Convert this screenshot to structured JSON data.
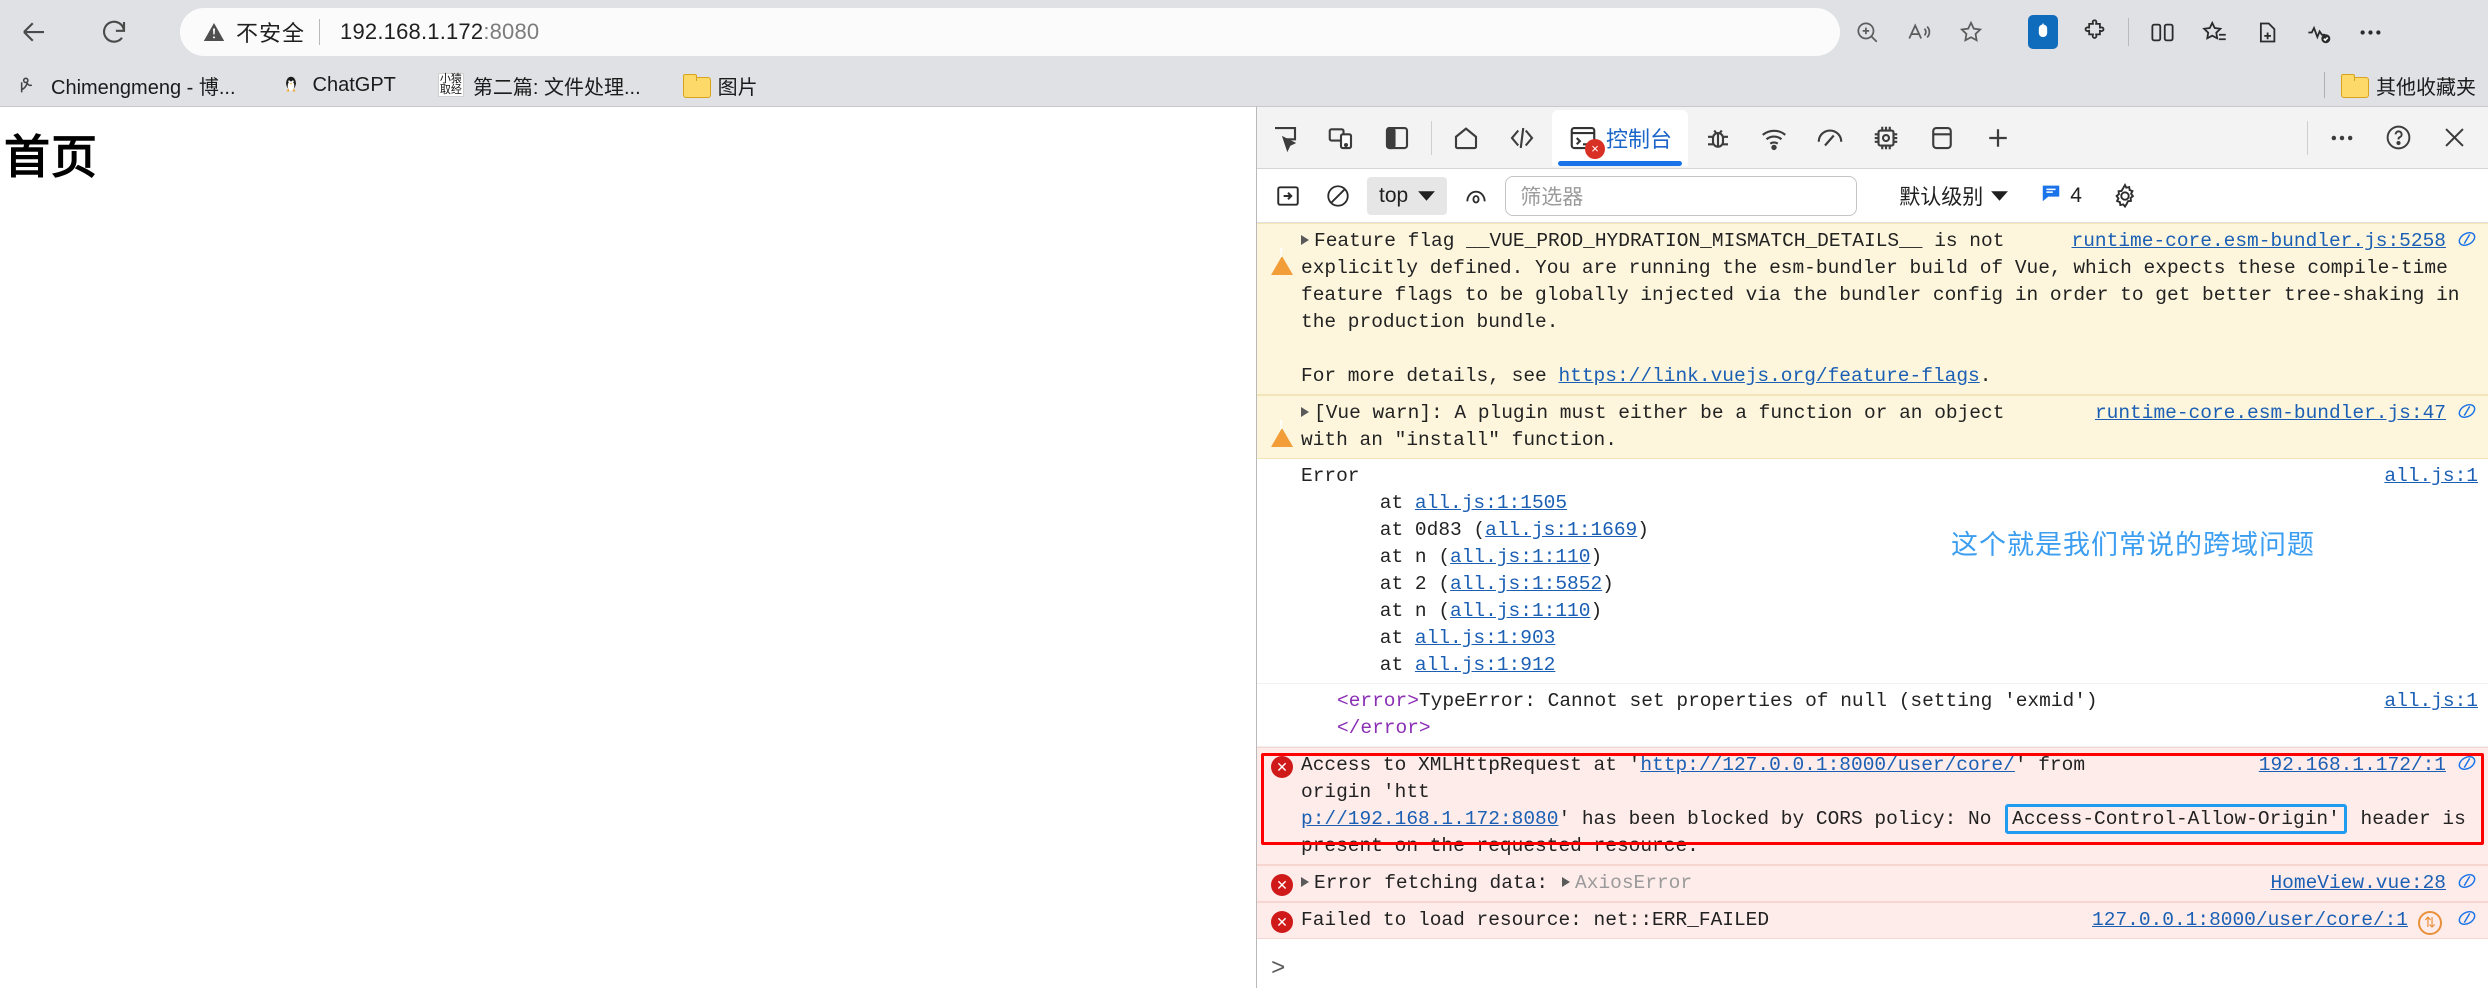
{
  "browser": {
    "nav": {
      "back": "back-arrow",
      "reload": "reload"
    },
    "omnibox": {
      "security_label": "不安全",
      "url_main": "192.168.1.172",
      "url_port": ":8080"
    },
    "bookmarks": [
      {
        "label": "Chimengmeng - 博...",
        "icon": "blog-icon"
      },
      {
        "label": "ChatGPT",
        "icon": "penguin-icon"
      },
      {
        "label": "第二篇: 文件处理...",
        "icon": "xiaoyuan-icon",
        "icon_text_1": "小猿",
        "icon_text_2": "取经"
      },
      {
        "label": "图片",
        "icon": "folder-icon"
      }
    ],
    "bookmarks_right": {
      "label": "其他收藏夹",
      "icon": "folder-icon"
    }
  },
  "page": {
    "title": "首页"
  },
  "devtools": {
    "toolbar": {
      "inspect": "inspect-element-icon",
      "device": "device-toolbar-icon",
      "dock": "dock-panel-icon",
      "home": "home-icon",
      "elements": "elements-code-icon",
      "console_tab": "控制台",
      "console_error_badge": "×",
      "debugger": "bug-icon",
      "network": "network-wifi-icon",
      "performance": "performance-gauge-icon",
      "memory": "memory-chip-icon",
      "application": "application-database-icon",
      "add_tab": "plus-icon",
      "more": "more-options-icon",
      "help": "help-icon",
      "close": "close-icon"
    },
    "filterbar": {
      "sidebar_toggle": "console-sidebar-icon",
      "clear": "clear-console-icon",
      "context": "top",
      "eye": "live-expression-icon",
      "filter_placeholder": "筛选器",
      "level": "默认级别",
      "issues_count": "4",
      "settings": "settings-gear-icon"
    },
    "console": {
      "rows": [
        {
          "id": "vue-feature-flag",
          "severity": "warning",
          "expandable": true,
          "text_line1": "Feature flag __VUE_PROD_HYDRATION_MISMATCH_DETAILS__ is not",
          "text_line2": "explicitly defined. You are running the esm-bundler build of Vue, which expects these compile-time",
          "text_line3": "feature flags to be globally injected via the bundler config in order to get better tree-shaking in",
          "text_line4": "the production bundle.",
          "text_line5_pre": "For more details, see ",
          "text_line5_link": "https://link.vuejs.org/feature-flags",
          "text_line5_post": ".",
          "source": "runtime-core.esm-bundler.js:5258"
        },
        {
          "id": "vue-plugin-warn",
          "severity": "warning",
          "expandable": true,
          "text_line1": "[Vue warn]: A plugin must either be a function or an object",
          "text_line2": "with an \"install\" function.",
          "source": "runtime-core.esm-bundler.js:47"
        },
        {
          "id": "error-stack",
          "severity": "none",
          "title": "Error",
          "source": "all.js:1",
          "stack": [
            {
              "prefix": "    at ",
              "link": "all.js:1:1505",
              "suffix": ""
            },
            {
              "prefix": "    at 0d83 (",
              "link": "all.js:1:1669",
              "suffix": ")"
            },
            {
              "prefix": "    at n (",
              "link": "all.js:1:110",
              "suffix": ")"
            },
            {
              "prefix": "    at 2 (",
              "link": "all.js:1:5852",
              "suffix": ")"
            },
            {
              "prefix": "    at n (",
              "link": "all.js:1:110",
              "suffix": ")"
            },
            {
              "prefix": "    at ",
              "link": "all.js:1:903",
              "suffix": ""
            },
            {
              "prefix": "    at ",
              "link": "all.js:1:912",
              "suffix": ""
            }
          ]
        },
        {
          "id": "error-tag-typeerror",
          "severity": "none",
          "tag_open": "<error>",
          "text": "TypeError: Cannot set properties of null (setting 'exmid')",
          "tag_close": "</error>",
          "source": "all.js:1"
        },
        {
          "id": "cors-error",
          "severity": "error",
          "text_pre": "Access to XMLHttpRequest at '",
          "link1": "http://127.0.0.1:8000/user/core/",
          "text_mid": "' from origin 'htt",
          "link2": "p://192.168.1.172:8080",
          "text_mid2": "' has been blocked by CORS policy: No ",
          "highlight": "Access-Control-Allow-Origin'",
          "text_post": " header is",
          "text_last": "present on the requested resource.",
          "source": "192.168.1.172/:1"
        },
        {
          "id": "axios-error",
          "severity": "error",
          "expandable": true,
          "text": "Error fetching data:",
          "text2": "AxiosError",
          "source": "HomeView.vue:28"
        },
        {
          "id": "failed-load",
          "severity": "error",
          "text": "Failed to load resource: net::ERR_FAILED",
          "source": "127.0.0.1:8000/user/core/:1",
          "has_issue_badge": true
        }
      ],
      "prompt": ">"
    },
    "annotation": "这个就是我们常说的跨域问题"
  }
}
